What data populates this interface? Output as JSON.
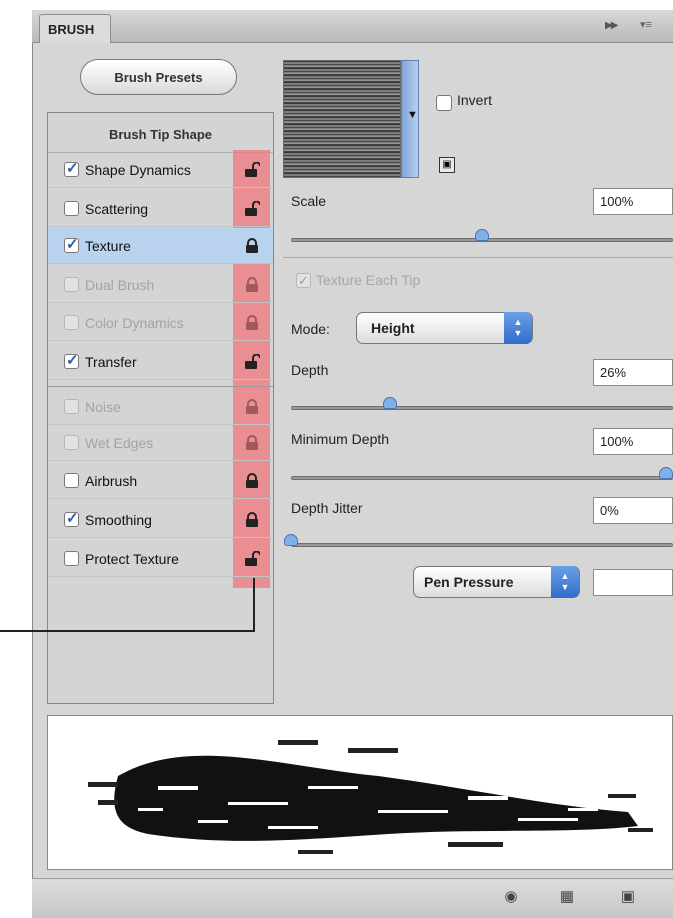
{
  "panel": {
    "tab_title": "BRUSH",
    "fly_icon": "double-arrow-icon",
    "menu_icon": "panel-menu-icon"
  },
  "presets_button": "Brush Presets",
  "tip_header": "Brush Tip Shape",
  "options": [
    {
      "label": "Shape Dynamics",
      "checked": true,
      "enabled": true,
      "selected": false,
      "lock": "unlocked"
    },
    {
      "label": "Scattering",
      "checked": false,
      "enabled": true,
      "selected": false,
      "lock": "unlocked"
    },
    {
      "label": "Texture",
      "checked": true,
      "enabled": true,
      "selected": true,
      "lock": "locked"
    },
    {
      "label": "Dual Brush",
      "checked": false,
      "enabled": false,
      "selected": false,
      "lock": "locked"
    },
    {
      "label": "Color Dynamics",
      "checked": false,
      "enabled": false,
      "selected": false,
      "lock": "locked"
    },
    {
      "label": "Transfer",
      "checked": true,
      "enabled": true,
      "selected": false,
      "lock": "unlocked"
    },
    {
      "label": "Noise",
      "checked": false,
      "enabled": false,
      "selected": false,
      "lock": "locked"
    },
    {
      "label": "Wet Edges",
      "checked": false,
      "enabled": false,
      "selected": false,
      "lock": "locked"
    },
    {
      "label": "Airbrush",
      "checked": false,
      "enabled": true,
      "selected": false,
      "lock": "locked"
    },
    {
      "label": "Smoothing",
      "checked": true,
      "enabled": true,
      "selected": false,
      "lock": "locked"
    },
    {
      "label": "Protect Texture",
      "checked": false,
      "enabled": true,
      "selected": false,
      "lock": "unlocked"
    }
  ],
  "texture": {
    "invert_label": "Invert",
    "invert_checked": false,
    "scale_label": "Scale",
    "scale_value": "100%",
    "scale_slider": 0.5,
    "texture_each_tip_label": "Texture Each Tip",
    "texture_each_tip_checked": true,
    "mode_label": "Mode:",
    "mode_value": "Height",
    "depth_label": "Depth",
    "depth_value": "26%",
    "depth_slider": 0.26,
    "min_depth_label": "Minimum Depth",
    "min_depth_value": "100%",
    "min_depth_slider": 1.0,
    "depth_jitter_label": "Depth Jitter",
    "depth_jitter_value": "0%",
    "depth_jitter_slider": 0.0,
    "control_value": "Pen Pressure",
    "control_field_value": ""
  },
  "bottom_icons": [
    "eye-brush-icon",
    "grid-icon",
    "new-brush-icon"
  ],
  "colors": {
    "selection": "#b9d2ee",
    "lock_highlight": "#f0787d",
    "slider_thumb": "#7fb0e8",
    "stepper": "#2f6ccb"
  }
}
